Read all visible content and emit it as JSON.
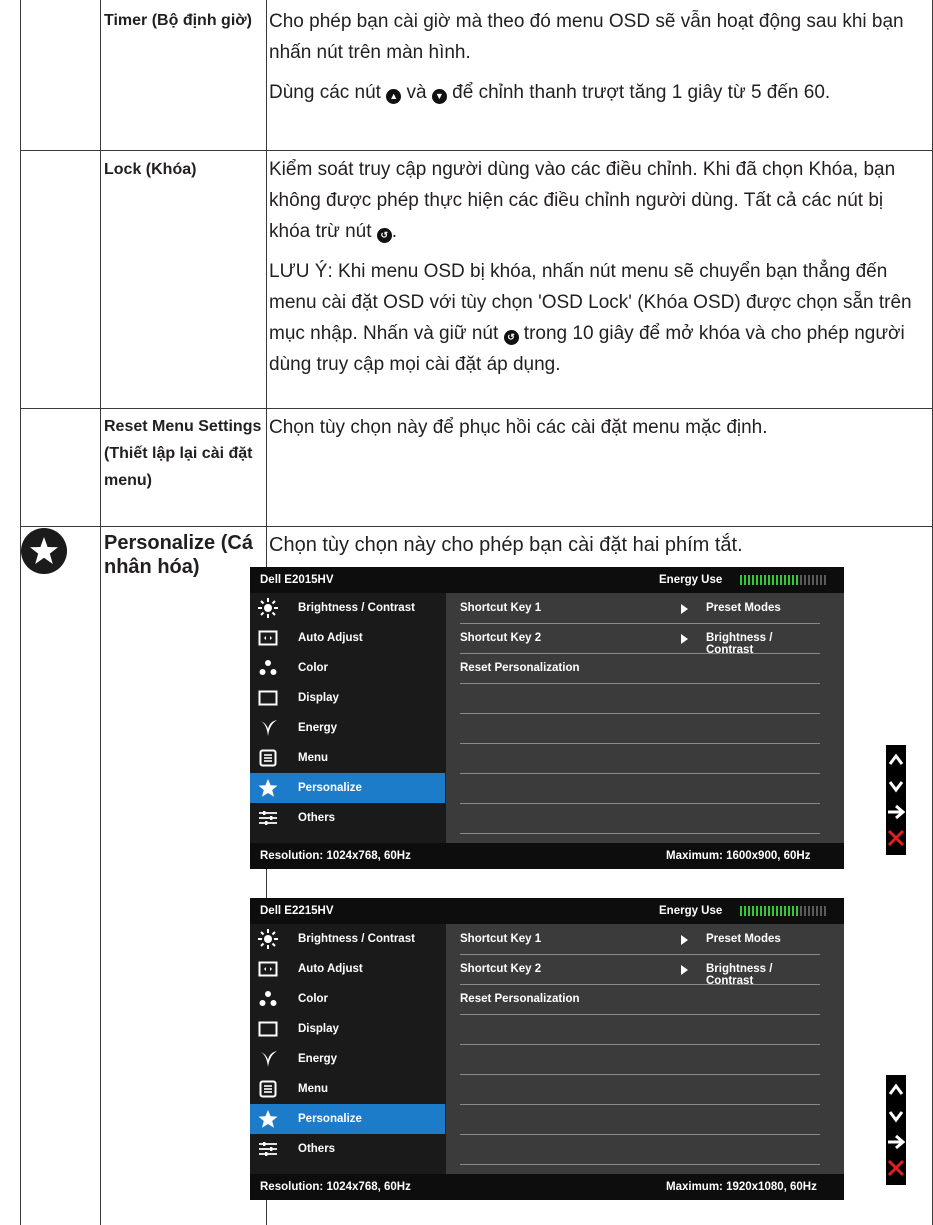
{
  "rows": {
    "timer": {
      "label": "Timer (Bộ định giờ)",
      "p1": "Cho phép bạn cài giờ mà theo đó menu OSD sẽ vẫn hoạt động sau khi bạn nhấn nút trên màn hình.",
      "p2_a": "Dùng các nút ",
      "p2_b": " và ",
      "p2_c": " để chỉnh thanh trượt tăng 1 giây từ 5 đến 60."
    },
    "lock": {
      "label": "Lock (Khóa)",
      "p1_a": "Kiểm soát truy cập người dùng vào các điều chỉnh. Khi đã chọn Khóa, bạn không được phép thực hiện các điều chỉnh người dùng. Tất cả các nút bị khóa trừ nút ",
      "p1_b": ".",
      "p2_a": "LƯU Ý: Khi menu OSD bị khóa, nhấn nút menu sẽ chuyển bạn thẳng đến menu cài đặt OSD với tùy chọn 'OSD Lock' (Khóa OSD) được chọn sẵn trên mục nhập. Nhấn và giữ nút ",
      "p2_b": " trong 10 giây để mở khóa và cho phép người dùng truy cập mọi cài đặt áp dụng."
    },
    "reset": {
      "label": "Reset Menu Settings (Thiết lập lại cài đặt menu)",
      "desc": "Chọn tùy chọn này để phục hồi các cài đặt menu mặc định."
    },
    "personalize": {
      "label": "Personalize (Cá nhân hóa)",
      "desc": "Chọn tùy chọn này cho phép bạn cài đặt hai phím tắt."
    }
  },
  "osd_menu": [
    "Brightness / Contrast",
    "Auto Adjust",
    "Color",
    "Display",
    "Energy",
    "Menu",
    "Personalize",
    "Others"
  ],
  "osd_selected": "Personalize",
  "osd_panel": {
    "shortcut1": "Shortcut Key 1",
    "shortcut1_val": "Preset Modes",
    "shortcut2": "Shortcut Key 2",
    "shortcut2_val": "Brightness / Contrast",
    "reset": "Reset Personalization"
  },
  "osd1": {
    "model": "Dell E2015HV",
    "energy": "Energy Use",
    "resolution": "Resolution: 1024x768, 60Hz",
    "maximum": "Maximum: 1600x900, 60Hz"
  },
  "osd2": {
    "model": "Dell E2215HV",
    "energy": "Energy Use",
    "resolution": "Resolution: 1024x768, 60Hz",
    "maximum": "Maximum: 1920x1080, 60Hz"
  },
  "colors": {
    "selected": "#1c7cc9",
    "energy_green": "#2ecc2e",
    "close_red": "#e02020"
  },
  "icons": [
    "up-circle-icon",
    "down-circle-icon",
    "back-circle-icon",
    "star-circle-icon",
    "up-arrow-icon",
    "down-arrow-icon",
    "right-arrow-icon",
    "close-x-icon"
  ]
}
